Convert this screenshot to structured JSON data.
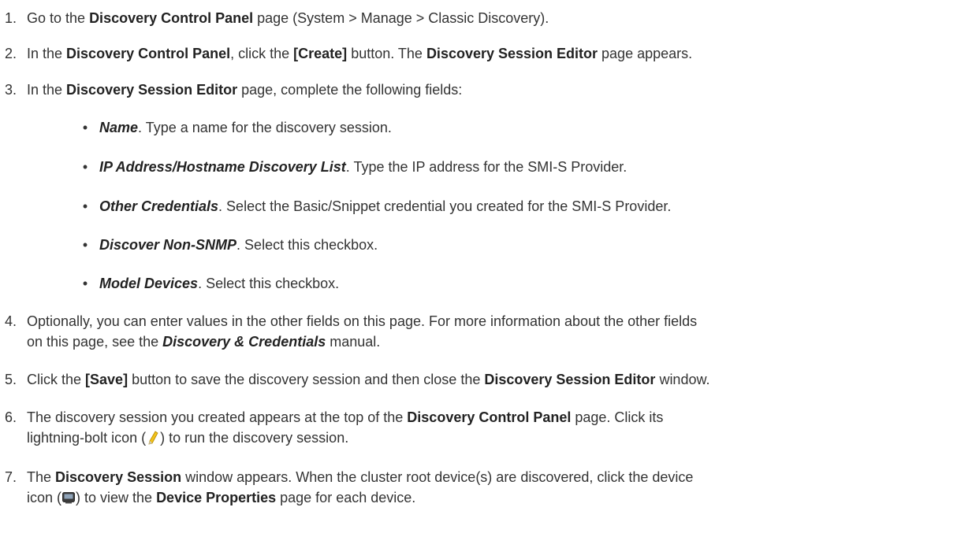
{
  "steps": [
    {
      "num": "1.",
      "t1": "Go to the ",
      "b1": "Discovery Control Panel",
      "t2": " page (System > Manage > Classic Discovery)."
    },
    {
      "num": "2.",
      "t1": "In the ",
      "b1": "Discovery Control Panel",
      "t2": ", click the ",
      "b2": "[Create]",
      "t3": " button. The ",
      "b3": "Discovery Session Editor",
      "t4": " page appears."
    },
    {
      "num": "3.",
      "t1": "In the ",
      "b1": "Discovery Session Editor",
      "t2": " page, complete the following fields:"
    },
    {
      "num": "4.",
      "line1": "Optionally, you can enter values in the other fields on this page. For more information about the other fields",
      "t1": "on this page, see the ",
      "bi1": "Discovery & Credentials",
      "t2": " manual."
    },
    {
      "num": "5.",
      "t1": "Click the ",
      "b1": "[Save]",
      "t2": " button to save the discovery session and then close the ",
      "b2": "Discovery Session Editor",
      "t3": " window."
    },
    {
      "num": "6.",
      "t1": "The discovery session you created appears at the top of the ",
      "b1": "Discovery Control Panel",
      "t2": " page. Click its",
      "t3": "lightning-bolt icon (",
      "t4": ") to run the discovery session."
    },
    {
      "num": "7.",
      "t1": "The ",
      "b1": "Discovery Session",
      "t2": " window appears. When the cluster root device(s) are discovered, click the device",
      "t3": "icon (",
      "t4": ") to view the ",
      "b2": "Device Properties",
      "t5": " page for each device."
    }
  ],
  "fields": [
    {
      "bullet": "•",
      "label": "Name",
      "desc": ". Type a name for the discovery session."
    },
    {
      "bullet": "•",
      "label": "IP Address/Hostname Discovery List",
      "desc": ". Type the IP address for the SMI-S Provider."
    },
    {
      "bullet": "•",
      "label": "Other Credentials",
      "desc": ". Select the Basic/Snippet credential you created for the SMI-S Provider."
    },
    {
      "bullet": "•",
      "label": "Discover Non-SNMP",
      "desc": ". Select this checkbox."
    },
    {
      "bullet": "•",
      "label": "Model Devices",
      "desc": ". Select this checkbox."
    }
  ],
  "icons": {
    "step6": "lightning-bolt-icon",
    "step7": "device-icon"
  },
  "colors": {
    "text": "#333333",
    "bold": "#222222",
    "bolt": "#f2c21b"
  }
}
